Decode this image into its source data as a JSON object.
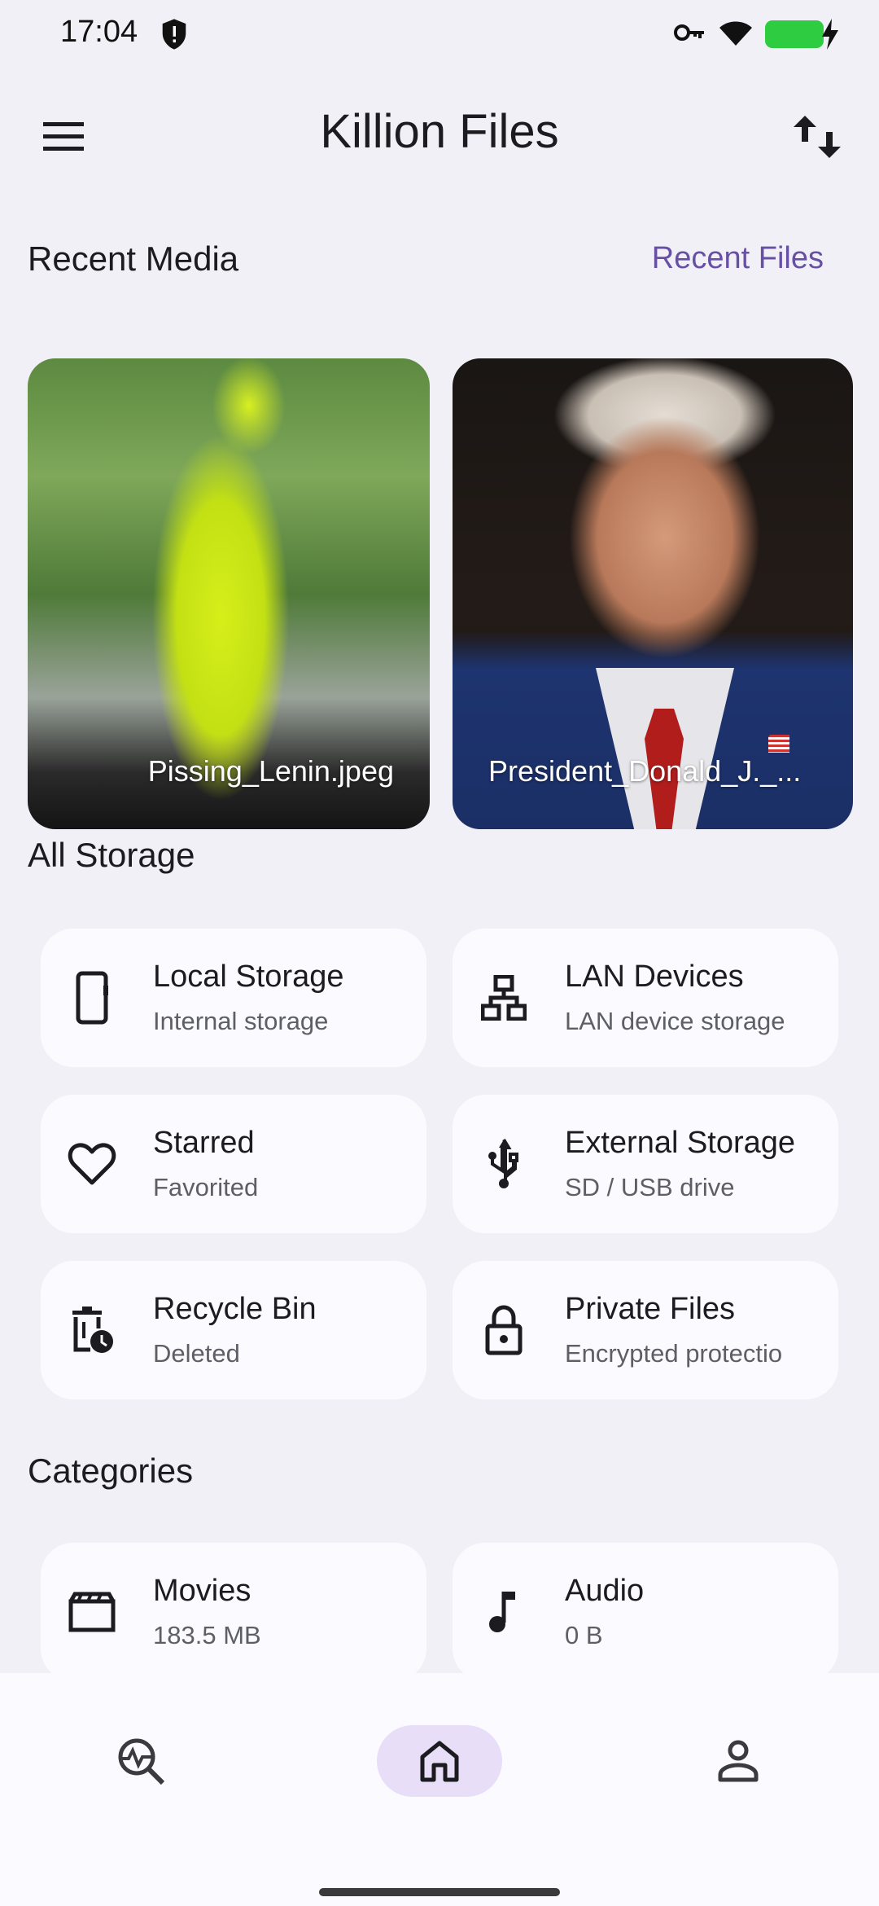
{
  "status_bar": {
    "time": "17:04",
    "icons": [
      "shield-icon",
      "vpn-key-icon",
      "wifi-icon",
      "battery-charging-icon"
    ]
  },
  "header": {
    "title": "Killion Files",
    "menu_icon": "menu-icon",
    "sort_icon": "swap-vert-icon"
  },
  "recent_media": {
    "title": "Recent Media",
    "link": "Recent Files",
    "items": [
      {
        "label": "Pissing_Lenin.jpeg"
      },
      {
        "label": "President_Donald_J._..."
      }
    ]
  },
  "all_storage": {
    "title": "All Storage",
    "items": [
      {
        "title": "Local Storage",
        "subtitle": "Internal storage",
        "icon": "phone-icon"
      },
      {
        "title": "LAN Devices",
        "subtitle": "LAN device storage",
        "icon": "lan-icon"
      },
      {
        "title": "Starred",
        "subtitle": "Favorited",
        "icon": "heart-icon"
      },
      {
        "title": "External Storage",
        "subtitle": "SD / USB drive",
        "icon": "usb-icon"
      },
      {
        "title": "Recycle Bin",
        "subtitle": "Deleted",
        "icon": "recycle-bin-icon"
      },
      {
        "title": "Private Files",
        "subtitle": "Encrypted protectio",
        "icon": "lock-icon"
      }
    ]
  },
  "categories": {
    "title": "Categories",
    "items": [
      {
        "title": "Movies",
        "subtitle": "183.5 MB",
        "icon": "movie-icon"
      },
      {
        "title": "Audio",
        "subtitle": "0 B",
        "icon": "music-note-icon"
      }
    ]
  },
  "bottom_nav": {
    "items": [
      {
        "icon": "analytics-search-icon",
        "selected": false
      },
      {
        "icon": "home-icon",
        "selected": true
      },
      {
        "icon": "person-icon",
        "selected": false
      }
    ],
    "accent": "#e8def8"
  },
  "colors": {
    "background": "#f1f0f7",
    "tile": "#fafaff",
    "accent": "#6750a4",
    "battery": "#2ecc40"
  }
}
